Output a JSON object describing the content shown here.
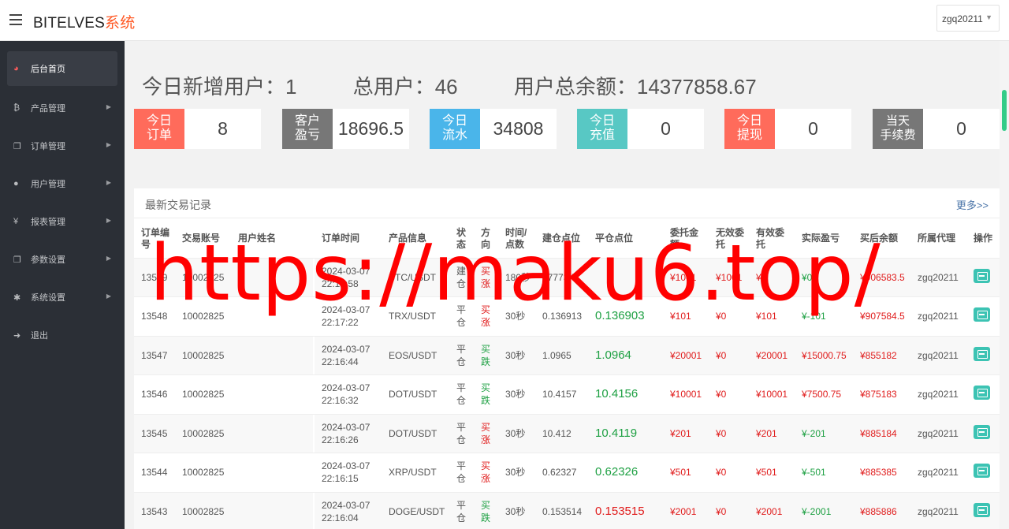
{
  "header": {
    "brand_main": "BITELVES",
    "brand_accent": "系统",
    "user": "zgq20211"
  },
  "sidebar": {
    "items": [
      {
        "label": "后台首页",
        "icon": "dashboard-icon",
        "glyph": "◕",
        "active": true
      },
      {
        "label": "产品管理",
        "icon": "bitcoin-icon",
        "glyph": "₿"
      },
      {
        "label": "订单管理",
        "icon": "copy-icon",
        "glyph": "❐"
      },
      {
        "label": "用户管理",
        "icon": "user-icon",
        "glyph": "●"
      },
      {
        "label": "报表管理",
        "icon": "yen-icon",
        "glyph": "¥"
      },
      {
        "label": "参数设置",
        "icon": "copy-icon",
        "glyph": "❐"
      },
      {
        "label": "系统设置",
        "icon": "gears-icon",
        "glyph": "✱"
      },
      {
        "label": "退出",
        "icon": "signout-icon",
        "glyph": "➜"
      }
    ]
  },
  "summary": {
    "new_users": "今日新增用户：1",
    "total_users": "总用户：46",
    "total_balance": "用户总余额：14377858.67"
  },
  "stats": [
    {
      "badge_line1": "今日",
      "badge_line2": "订单",
      "value": "8",
      "color": "#ff6b5b"
    },
    {
      "badge_line1": "客户",
      "badge_line2": "盈亏",
      "value": "18696.5",
      "color": "#777777"
    },
    {
      "badge_line1": "今日",
      "badge_line2": "流水",
      "value": "34808",
      "color": "#4ab5ea"
    },
    {
      "badge_line1": "今日",
      "badge_line2": "充值",
      "value": "0",
      "color": "#58c8c4"
    },
    {
      "badge_line1": "今日",
      "badge_line2": "提现",
      "value": "0",
      "color": "#ff6b5b"
    },
    {
      "badge_line1": "当天",
      "badge_line2": "手续费",
      "value": "0",
      "color": "#777777"
    }
  ],
  "panel": {
    "title": "最新交易记录",
    "more": "更多>>"
  },
  "table": {
    "headers": [
      "订单编号",
      "交易账号",
      "用户姓名",
      "",
      "订单时间",
      "产品信息",
      "状态",
      "方向",
      "时间/点数",
      "建仓点位",
      "平仓点位",
      "委托金额",
      "无效委托",
      "有效委托",
      "实际盈亏",
      "买后余额",
      "所属代理",
      "操作"
    ],
    "rows": [
      {
        "id": "13549",
        "account": "10002825",
        "name": "",
        "date": "2024-03-07",
        "time": "22:17:58",
        "product": "BTC/USDT",
        "status": "建仓",
        "direction": "买涨",
        "dir_color": "red",
        "period": "180秒",
        "open": "67773.5",
        "close": "",
        "close_color": "green",
        "amount": "¥1001",
        "invalid": "¥1001",
        "valid": "¥0",
        "profit": "¥0",
        "profit_color": "green",
        "balance": "¥906583.5",
        "agent": "zgq20211"
      },
      {
        "id": "13548",
        "account": "10002825",
        "name": "",
        "date": "2024-03-07",
        "time": "22:17:22",
        "product": "TRX/USDT",
        "status": "平仓",
        "direction": "买涨",
        "dir_color": "red",
        "period": "30秒",
        "open": "0.136913",
        "close": "0.136903",
        "close_color": "green",
        "amount": "¥101",
        "invalid": "¥0",
        "valid": "¥101",
        "profit": "¥-101",
        "profit_color": "green",
        "balance": "¥907584.5",
        "agent": "zgq20211"
      },
      {
        "id": "13547",
        "account": "10002825",
        "name": "",
        "date": "2024-03-07",
        "time": "22:16:44",
        "product": "EOS/USDT",
        "status": "平仓",
        "direction": "买跌",
        "dir_color": "green",
        "period": "30秒",
        "open": "1.0965",
        "close": "1.0964",
        "close_color": "green",
        "amount": "¥20001",
        "invalid": "¥0",
        "valid": "¥20001",
        "profit": "¥15000.75",
        "profit_color": "red",
        "balance": "¥855182",
        "agent": "zgq20211"
      },
      {
        "id": "13546",
        "account": "10002825",
        "name": "",
        "date": "2024-03-07",
        "time": "22:16:32",
        "product": "DOT/USDT",
        "status": "平仓",
        "direction": "买跌",
        "dir_color": "green",
        "period": "30秒",
        "open": "10.4157",
        "close": "10.4156",
        "close_color": "green",
        "amount": "¥10001",
        "invalid": "¥0",
        "valid": "¥10001",
        "profit": "¥7500.75",
        "profit_color": "red",
        "balance": "¥875183",
        "agent": "zgq20211"
      },
      {
        "id": "13545",
        "account": "10002825",
        "name": "",
        "date": "2024-03-07",
        "time": "22:16:26",
        "product": "DOT/USDT",
        "status": "平仓",
        "direction": "买涨",
        "dir_color": "red",
        "period": "30秒",
        "open": "10.412",
        "close": "10.4119",
        "close_color": "green",
        "amount": "¥201",
        "invalid": "¥0",
        "valid": "¥201",
        "profit": "¥-201",
        "profit_color": "green",
        "balance": "¥885184",
        "agent": "zgq20211"
      },
      {
        "id": "13544",
        "account": "10002825",
        "name": "",
        "date": "2024-03-07",
        "time": "22:16:15",
        "product": "XRP/USDT",
        "status": "平仓",
        "direction": "买涨",
        "dir_color": "red",
        "period": "30秒",
        "open": "0.62327",
        "close": "0.62326",
        "close_color": "green",
        "amount": "¥501",
        "invalid": "¥0",
        "valid": "¥501",
        "profit": "¥-501",
        "profit_color": "green",
        "balance": "¥885385",
        "agent": "zgq20211"
      },
      {
        "id": "13543",
        "account": "10002825",
        "name": "",
        "date": "2024-03-07",
        "time": "22:16:04",
        "product": "DOGE/USDT",
        "status": "平仓",
        "direction": "买跌",
        "dir_color": "green",
        "period": "30秒",
        "open": "0.153514",
        "close": "0.153515",
        "close_color": "red",
        "amount": "¥2001",
        "invalid": "¥0",
        "valid": "¥2001",
        "profit": "¥-2001",
        "profit_color": "green",
        "balance": "¥885886",
        "agent": "zgq20211"
      }
    ]
  },
  "watermark": "https://maku6.top/"
}
